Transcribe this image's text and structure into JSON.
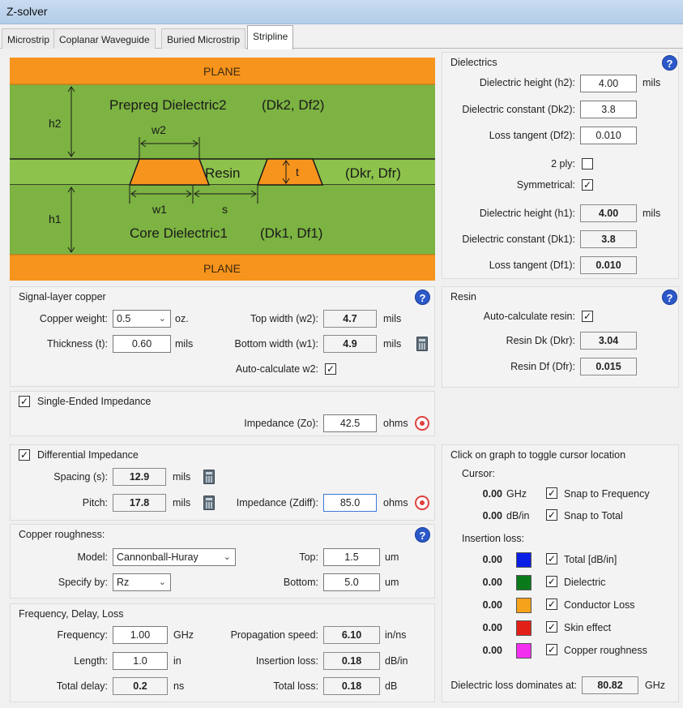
{
  "window": {
    "title": "Z-solver"
  },
  "tabs": [
    {
      "label": "Microstrip"
    },
    {
      "label": "Coplanar Waveguide"
    },
    {
      "label": "Buried Microstrip"
    },
    {
      "label": "Stripline"
    }
  ],
  "diagram": {
    "plane_top": "PLANE",
    "plane_bottom": "PLANE",
    "h2": "h2",
    "h1": "h1",
    "prepreg": "Prepreg Dielectric2",
    "prepreg_params": "(Dk2, Df2)",
    "core": "Core Dielectric1",
    "core_params": "(Dk1, Df1)",
    "resin": "Resin",
    "resin_params": "(Dkr, Dfr)",
    "w2": "w2",
    "w1": "w1",
    "s": "s",
    "t": "t",
    "colors": {
      "plane": "#f7941d",
      "dielectric": "#7cb342",
      "copper": "#f7941d",
      "line": "#1a1a1a"
    }
  },
  "dielectrics": {
    "title": "Dielectrics",
    "height_h2_label": "Dielectric height (h2):",
    "height_h2": "4.00",
    "height_h2_unit": "mils",
    "dk2_label": "Dielectric constant (Dk2):",
    "dk2": "3.8",
    "df2_label": "Loss tangent (Df2):",
    "df2": "0.010",
    "two_ply_label": "2 ply:",
    "two_ply_checked": "",
    "symmetrical_label": "Symmetrical:",
    "symmetrical_checked": "✓",
    "height_h1_label": "Dielectric height (h1):",
    "height_h1": "4.00",
    "height_h1_unit": "mils",
    "dk1_label": "Dielectric constant (Dk1):",
    "dk1": "3.8",
    "df1_label": "Loss tangent (Df1):",
    "df1": "0.010"
  },
  "resin": {
    "title": "Resin",
    "auto_label": "Auto-calculate resin:",
    "auto_checked": "✓",
    "dk_label": "Resin Dk (Dkr):",
    "dk": "3.04",
    "df_label": "Resin Df (Dfr):",
    "df": "0.015"
  },
  "signal": {
    "title": "Signal-layer copper",
    "copper_weight_label": "Copper weight:",
    "copper_weight": "0.5",
    "copper_weight_unit": "oz.",
    "thickness_label": "Thickness (t):",
    "thickness": "0.60",
    "thickness_unit": "mils",
    "top_width_label": "Top width (w2):",
    "top_width": "4.7",
    "top_width_unit": "mils",
    "bottom_width_label": "Bottom width (w1):",
    "bottom_width": "4.9",
    "bottom_width_unit": "mils",
    "auto_w2_label": "Auto-calculate w2:",
    "auto_w2_checked": "✓"
  },
  "single_ended": {
    "checked": "✓",
    "title": "Single-Ended Impedance",
    "impedance_label": "Impedance (Zo):",
    "impedance": "42.5",
    "unit": "ohms"
  },
  "differential": {
    "checked": "✓",
    "title": "Differential Impedance",
    "spacing_label": "Spacing (s):",
    "spacing": "12.9",
    "spacing_unit": "mils",
    "pitch_label": "Pitch:",
    "pitch": "17.8",
    "pitch_unit": "mils",
    "impedance_label": "Impedance (Zdiff):",
    "impedance": "85.0",
    "unit": "ohms"
  },
  "roughness": {
    "title": "Copper roughness:",
    "model_label": "Model:",
    "model": "Cannonball-Huray",
    "specify_label": "Specify by:",
    "specify": "Rz",
    "top_label": "Top:",
    "top": "1.5",
    "top_unit": "um",
    "bottom_label": "Bottom:",
    "bottom": "5.0",
    "bottom_unit": "um"
  },
  "freq": {
    "title": "Frequency, Delay, Loss",
    "frequency_label": "Frequency:",
    "frequency": "1.00",
    "frequency_unit": "GHz",
    "length_label": "Length:",
    "length": "1.0",
    "length_unit": "in",
    "delay_label": "Total delay:",
    "delay": "0.2",
    "delay_unit": "ns",
    "prop_label": "Propagation speed:",
    "prop": "6.10",
    "prop_unit": "in/ns",
    "insertion_label": "Insertion loss:",
    "insertion": "0.18",
    "insertion_unit": "dB/in",
    "total_label": "Total loss:",
    "total": "0.18",
    "total_unit": "dB"
  },
  "graph": {
    "hint": "Click on graph to toggle cursor location",
    "cursor_label": "Cursor:",
    "cursor_freq": "0.00",
    "cursor_freq_unit": "GHz",
    "snap_freq_label": "Snap to Frequency",
    "snap_freq_checked": "✓",
    "cursor_db": "0.00",
    "cursor_db_unit": "dB/in",
    "snap_total_label": "Snap to Total",
    "snap_total_checked": "✓",
    "insertion_label": "Insertion loss:",
    "items": [
      {
        "value": "0.00",
        "color": "#0a1fe6",
        "checked": "✓",
        "label": "Total [dB/in]"
      },
      {
        "value": "0.00",
        "color": "#0a7a1a",
        "checked": "✓",
        "label": "Dielectric"
      },
      {
        "value": "0.00",
        "color": "#f7a21b",
        "checked": "✓",
        "label": "Conductor Loss"
      },
      {
        "value": "0.00",
        "color": "#e32018",
        "checked": "✓",
        "label": "Skin effect"
      },
      {
        "value": "0.00",
        "color": "#f42ef0",
        "checked": "✓",
        "label": "Copper roughness"
      }
    ],
    "dominates_label": "Dielectric loss dominates at:",
    "dominates": "80.82",
    "dominates_unit": "GHz"
  }
}
